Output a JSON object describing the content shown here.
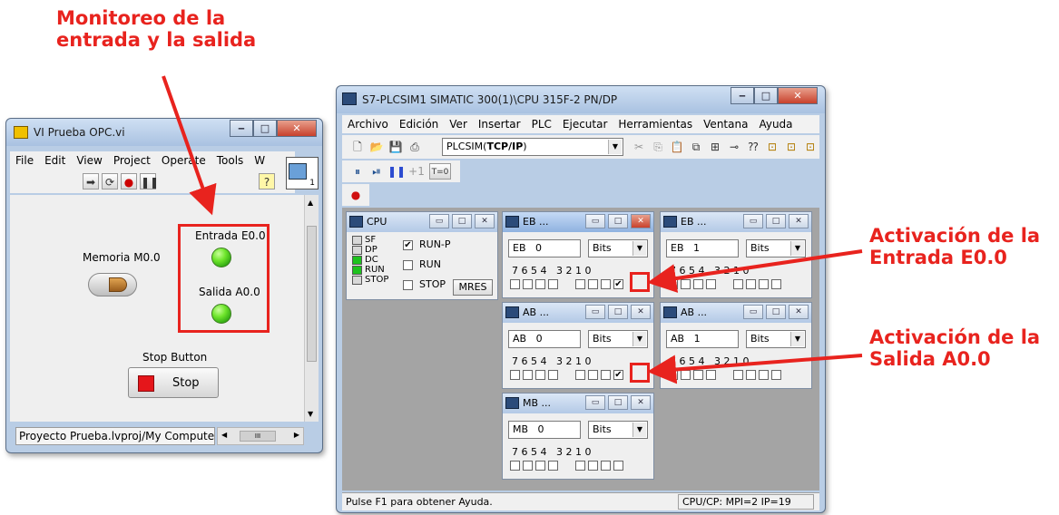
{
  "annotations": {
    "monitor": "Monitoreo de la\nentrada y la salida",
    "input_act": "Activación de la\nEntrada E0.0",
    "output_act": "Activación de la\nSalida A0.0",
    "color": "#e8231e"
  },
  "labview": {
    "title": "VI Prueba OPC.vi",
    "menu": [
      "File",
      "Edit",
      "View",
      "Project",
      "Operate",
      "Tools",
      "W"
    ],
    "memory_label": "Memoria M0.0",
    "input_label": "Entrada E0.0",
    "output_label": "Salida A0.0",
    "stop_caption": "Stop Button",
    "stop_label": "Stop",
    "status_path": "Proyecto Prueba.lvproj/My Computer",
    "scroll_mark": "III",
    "help_glyph": "?",
    "badge": "1",
    "led_color": "#6ee52b",
    "stop_color": "#e5161b"
  },
  "plcsim": {
    "title": "S7-PLCSIM1    SIMATIC 300(1)\\CPU 315F-2 PN/DP",
    "menu": [
      "Archivo",
      "Edición",
      "Ver",
      "Insertar",
      "PLC",
      "Ejecutar",
      "Herramientas",
      "Ventana",
      "Ayuda"
    ],
    "connection_prefix": "PLCSIM(",
    "connection_bold": "TCP/IP",
    "connection_suffix": ")",
    "toolbar2": {
      "plus1": "+1",
      "t0": "T=0"
    },
    "status_left": "Pulse F1 para obtener Ayuda.",
    "status_right": "CPU/CP:  MPI=2 IP=19",
    "cpu": {
      "title": "CPU",
      "leds": [
        {
          "label": "SF",
          "on": false
        },
        {
          "label": "DP",
          "on": false
        },
        {
          "label": "DC",
          "on": true
        },
        {
          "label": "RUN",
          "on": true
        },
        {
          "label": "STOP",
          "on": false
        }
      ],
      "modes": [
        {
          "label": "RUN-P",
          "checked": true
        },
        {
          "label": "RUN",
          "checked": false
        },
        {
          "label": "STOP",
          "checked": false
        }
      ],
      "mres": "MRES"
    },
    "bits_header": "7 6 5 4   3 2 1 0",
    "modules": [
      {
        "title": "EB ...",
        "area": "EB",
        "address": "0",
        "format": "Bits",
        "checked_bit": 0,
        "active": true
      },
      {
        "title": "EB ...",
        "area": "EB",
        "address": "1",
        "format": "Bits",
        "checked_bit": null,
        "active": false
      },
      {
        "title": "AB ...",
        "area": "AB",
        "address": "0",
        "format": "Bits",
        "checked_bit": 0,
        "active": false
      },
      {
        "title": "AB ...",
        "area": "AB",
        "address": "1",
        "format": "Bits",
        "checked_bit": null,
        "active": false
      },
      {
        "title": "MB ...",
        "area": "MB",
        "address": "0",
        "format": "Bits",
        "checked_bit": null,
        "active": false
      }
    ]
  }
}
